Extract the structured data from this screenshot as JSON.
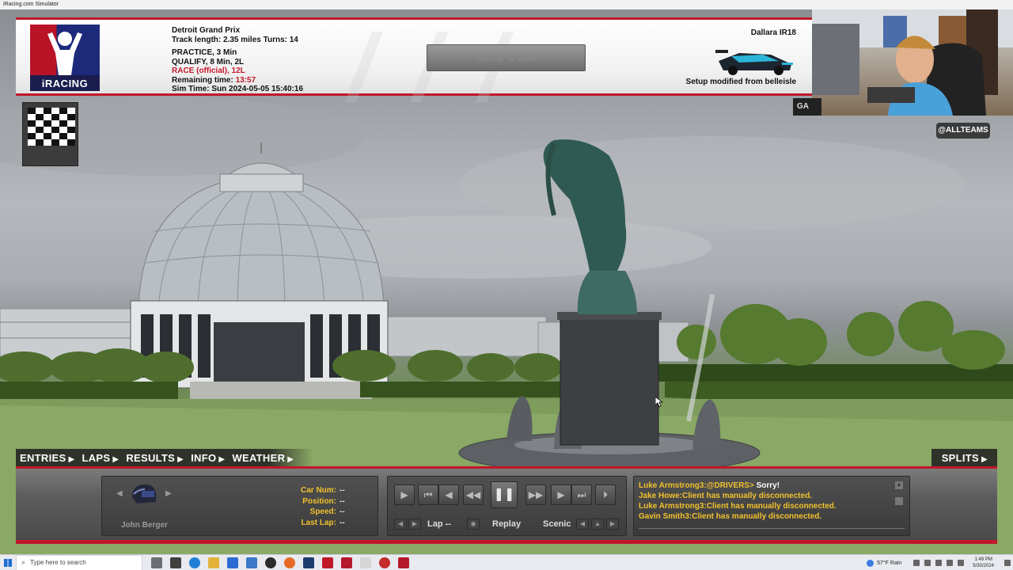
{
  "window": {
    "title": "iRacing.com Simulator"
  },
  "header": {
    "logo_word": "iRACING",
    "event_name": "Detroit Grand Prix",
    "track_info": "Track length: 2.35 miles Turns: 14",
    "practice": "PRACTICE, 3 Min",
    "qualify": "QUALIFY, 8 Min, 2L",
    "race": "RACE (official), 12L",
    "remaining_label": "Remaining time:",
    "remaining_value": "13:57",
    "sim_time": "Sim Time: Sun 2024-05-05 15:40:16",
    "race_over_button": "RACE OVER",
    "car_name": "Dallara IR18",
    "setup_text": "Setup modified from belleisle"
  },
  "webcam": {
    "tag": "GA"
  },
  "team_badge": "@ALLTEAMS",
  "nav": {
    "tabs": [
      "ENTRIES",
      "LAPS",
      "RESULTS",
      "INFO",
      "WEATHER"
    ],
    "splits": "SPLITS"
  },
  "driver": {
    "name": "John Berger",
    "stats": [
      {
        "label": "Car Num:",
        "value": "--"
      },
      {
        "label": "Position:",
        "value": "--"
      },
      {
        "label": "Speed:",
        "value": "--"
      },
      {
        "label": "Last Lap:",
        "value": "--"
      }
    ]
  },
  "replay": {
    "lap_label": "Lap --",
    "replay_label": "Replay",
    "camera_label": "Scenic"
  },
  "chat": [
    {
      "who": "Luke Armstrong3:@DRIVERS>",
      "msg": "Sorry!",
      "white": true
    },
    {
      "who": "",
      "msg": "Jake Howe:Client has manually disconnected.",
      "white": false
    },
    {
      "who": "",
      "msg": "Luke Armstrong3:Client has manually disconnected.",
      "white": false
    },
    {
      "who": "",
      "msg": "Gavin Smith3:Client has manually disconnected.",
      "white": false
    }
  ],
  "taskbar": {
    "search_placeholder": "Type here to search",
    "weather": "57°F Rain",
    "time": "1:49 PM",
    "date": "5/30/2024"
  },
  "colors": {
    "accent_red": "#c0182a",
    "chat_yellow": "#f2c12e"
  }
}
